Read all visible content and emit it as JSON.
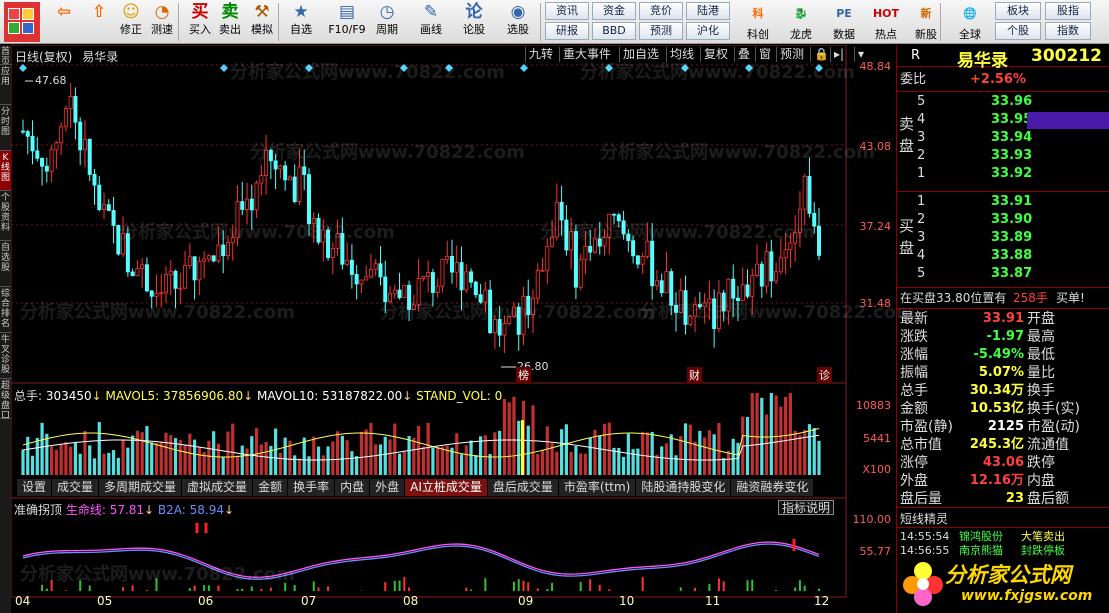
{
  "toolbar": {
    "items": [
      {
        "name": "back-button",
        "label": "",
        "icon": "⇦"
      },
      {
        "name": "up-button",
        "label": "",
        "icon": "⇧"
      },
      {
        "name": "refresh-button",
        "label": "修正",
        "icon": "☺"
      },
      {
        "name": "test-button",
        "label": "测速",
        "icon": "◔"
      },
      {
        "name": "buy-button",
        "label": "买入",
        "icon": "买"
      },
      {
        "name": "sell-button",
        "label": "卖出",
        "icon": "卖"
      },
      {
        "name": "simulate-button",
        "label": "模拟",
        "icon": "⚒"
      },
      {
        "name": "watchlist-button",
        "label": "自选",
        "icon": "★"
      },
      {
        "name": "f10-button",
        "label": "F10/F9",
        "icon": "▤"
      },
      {
        "name": "period-button",
        "label": "周期",
        "icon": "◷"
      },
      {
        "name": "draw-button",
        "label": "画线",
        "icon": "✎"
      },
      {
        "name": "discuss-button",
        "label": "论股",
        "icon": "论"
      },
      {
        "name": "stockpick-button",
        "label": "选股",
        "icon": "◉"
      }
    ],
    "grid": [
      [
        "资讯",
        "资金",
        "竞价",
        "陆港"
      ],
      [
        "研报",
        "BBD",
        "预测",
        "沪化"
      ]
    ],
    "big": [
      {
        "name": "kechuang-button",
        "label": "科创",
        "icon": "科"
      },
      {
        "name": "dragon-tiger-button",
        "label": "龙虎",
        "icon": "🐉"
      },
      {
        "name": "data-button",
        "label": "数据",
        "icon": "PE"
      },
      {
        "name": "hot-button",
        "label": "热点",
        "icon": "HOT"
      },
      {
        "name": "ipo-button",
        "label": "新股",
        "icon": "新"
      },
      {
        "name": "global-button",
        "label": "全球",
        "icon": "🌐"
      }
    ],
    "right_grid": [
      [
        "板块",
        "股指"
      ],
      [
        "个股",
        "指数"
      ]
    ]
  },
  "left_tabs": [
    {
      "label": "首页",
      "on": false
    },
    {
      "label": "应用",
      "on": false
    },
    {
      "label": "分时图",
      "on": false
    },
    {
      "label": "K线图",
      "on": true
    },
    {
      "label": "个股资料",
      "on": false
    },
    {
      "label": "自选股",
      "on": false
    },
    {
      "label": "综合排名",
      "on": false
    },
    {
      "label": "牛叉诊股",
      "on": false
    },
    {
      "label": "超级盘口",
      "on": false
    }
  ],
  "chart": {
    "header": {
      "period": "日线(复权)",
      "name": "易华录"
    },
    "buttons": [
      "九转",
      "重大事件",
      "加自选",
      "均线",
      "复权",
      "叠",
      "窗",
      "预测"
    ],
    "price_axis": [
      "48.84",
      "43.08",
      "37.24",
      "31.48"
    ],
    "high_label": "47.68",
    "low_label": "26.80",
    "markers": [
      "榜",
      "财",
      "诊"
    ],
    "vol_line": {
      "prefix": "总手: ",
      "total": "303450",
      "mavol5_label": "MAVOL5: ",
      "mavol5": "37856906.80",
      "mavol10_label": "MAVOL10: ",
      "mavol10": "53187822.00",
      "stand_label": "STAND_VOL: ",
      "stand": "0"
    },
    "vol_axis": [
      "10883",
      "5441"
    ],
    "vol_unit": "X100",
    "tabs": [
      {
        "label": "设置",
        "on": false
      },
      {
        "label": "成交量",
        "on": false
      },
      {
        "label": "多周期成交量",
        "on": false
      },
      {
        "label": "虚拟成交量",
        "on": false
      },
      {
        "label": "金额",
        "on": false
      },
      {
        "label": "换手率",
        "on": false
      },
      {
        "label": "内盘",
        "on": false
      },
      {
        "label": "外盘",
        "on": false
      },
      {
        "label": "AI立桩成交量",
        "on": true
      },
      {
        "label": "盘后成交量",
        "on": false
      },
      {
        "label": "市盈率(ttm)",
        "on": false
      },
      {
        "label": "陆股通持股变化",
        "on": false
      },
      {
        "label": "融资融券变化",
        "on": false
      }
    ],
    "ind_line": {
      "name": "准确拐顶 ",
      "life_label": "生命线: ",
      "life": "57.81",
      "b2a_label": "B2A: ",
      "b2a": "58.94"
    },
    "ind_button": "指标说明",
    "ind_axis": [
      "110.00",
      "55.77"
    ],
    "months": [
      "04",
      "05",
      "06",
      "07",
      "08",
      "09",
      "10",
      "11",
      "12"
    ]
  },
  "quote": {
    "badge": "R",
    "name": "易华录",
    "code": "300212",
    "wei_label": "委比",
    "wei": "+2.56%",
    "sell_label": "卖盘",
    "buy_label": "买盘",
    "sell": [
      {
        "n": "5",
        "p": "33.96"
      },
      {
        "n": "4",
        "p": "33.95"
      },
      {
        "n": "3",
        "p": "33.94"
      },
      {
        "n": "2",
        "p": "33.93"
      },
      {
        "n": "1",
        "p": "33.92"
      }
    ],
    "buy": [
      {
        "n": "1",
        "p": "33.91"
      },
      {
        "n": "2",
        "p": "33.90"
      },
      {
        "n": "3",
        "p": "33.89"
      },
      {
        "n": "4",
        "p": "33.88"
      },
      {
        "n": "5",
        "p": "33.87"
      }
    ],
    "notice": {
      "text": "在买盘33.80位置有",
      "qty": "258手",
      "action": "买单!"
    },
    "stats": [
      {
        "l": "最新",
        "v": "33.91",
        "c": "#ff4040",
        "r": "开盘"
      },
      {
        "l": "涨跌",
        "v": "-1.97",
        "c": "#40ff40",
        "r": "最高"
      },
      {
        "l": "涨幅",
        "v": "-5.49%",
        "c": "#40ff40",
        "r": "最低"
      },
      {
        "l": "振幅",
        "v": "5.07%",
        "c": "#ffff40",
        "r": "量比"
      },
      {
        "l": "总手",
        "v": "30.34万",
        "c": "#ffff40",
        "r": "换手"
      },
      {
        "l": "金额",
        "v": "10.53亿",
        "c": "#ffff40",
        "r": "换手(实)"
      },
      {
        "l": "市盈(静)",
        "v": "2125",
        "c": "#ffffff",
        "r": "市盈(动)"
      },
      {
        "l": "总市值",
        "v": "245.3亿",
        "c": "#ffff40",
        "r": "流通值"
      },
      {
        "l": "涨停",
        "v": "43.06",
        "c": "#ff4040",
        "r": "跌停"
      },
      {
        "l": "外盘",
        "v": "12.16万",
        "c": "#ff4040",
        "r": "内盘"
      },
      {
        "l": "盘后量",
        "v": "23",
        "c": "#ffff40",
        "r": "盘后额"
      }
    ],
    "jingling_title": "短线精灵",
    "jingling": [
      {
        "t": "14:55:54",
        "s": "锦鸿股份",
        "e": "大笔卖出"
      },
      {
        "t": "14:56:55",
        "s": "南京熊猫",
        "e": "封跌停板"
      }
    ]
  },
  "logo": {
    "text": "分析家公式网",
    "url": "www.fxjgsw.com"
  },
  "watermark": "分析家公式网www.70822.com"
}
